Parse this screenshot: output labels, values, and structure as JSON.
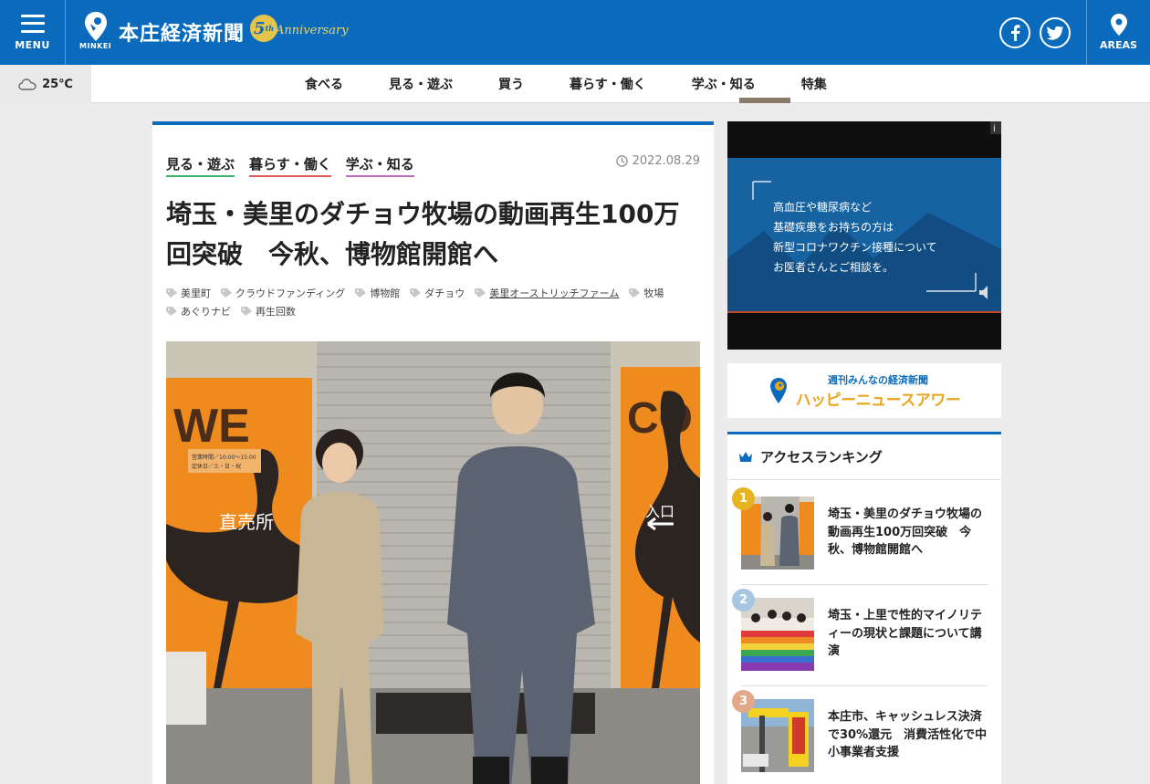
{
  "header": {
    "menu_label": "MENU",
    "site_name": "本庄経済新聞",
    "brand_sub": "MINKEI",
    "anniversary_number": "5",
    "anniversary_suffix": "th",
    "anniversary_word": "Anniversary",
    "areas_label": "AREAS",
    "brand_color": "#0a6bbd"
  },
  "weather": {
    "temperature": "25℃",
    "icon": "cloud-icon"
  },
  "nav": {
    "items": [
      {
        "label": "食べる"
      },
      {
        "label": "見る・遊ぶ"
      },
      {
        "label": "買う"
      },
      {
        "label": "暮らす・働く"
      },
      {
        "label": "学ぶ・知る"
      },
      {
        "label": "特集"
      }
    ]
  },
  "article": {
    "categories": [
      {
        "label": "見る・遊ぶ",
        "color": "#3bb36b"
      },
      {
        "label": "暮らす・働く",
        "color": "#e05a5a"
      },
      {
        "label": "学ぶ・知る",
        "color": "#c06ab3"
      }
    ],
    "date": "2022.08.29",
    "title": "埼玉・美里のダチョウ牧場の動画再生100万回突破　今秋、博物館開館へ",
    "tags": [
      {
        "label": "美里町"
      },
      {
        "label": "クラウドファンディング"
      },
      {
        "label": "博物館"
      },
      {
        "label": "ダチョウ"
      },
      {
        "label": "美里オーストリッチファーム"
      },
      {
        "label": "牧場"
      },
      {
        "label": "あぐりナビ"
      },
      {
        "label": "再生回数"
      }
    ],
    "photo": {
      "sign_left": "直売所",
      "sign_right": "入口",
      "hours_line1": "営業時間／10:00～15:00",
      "hours_line2": "定休日／土・日・祝",
      "wall_text_left": "WE",
      "wall_text_right": "CO"
    }
  },
  "ad": {
    "lines": [
      "高血圧や糖尿病など",
      "基礎疾患をお持ちの方は",
      "新型コロナワクチン接種について",
      "お医者さんとご相談を。"
    ],
    "info_badge": "i"
  },
  "happy": {
    "line1": "週刊みんなの経済新聞",
    "line2": "ハッピーニュースアワー"
  },
  "ranking": {
    "title": "アクセスランキング",
    "items": [
      {
        "rank": "1",
        "title": "埼玉・美里のダチョウ牧場の動画再生100万回突破　今秋、博物館開館へ",
        "badge_color": "#e6b422"
      },
      {
        "rank": "2",
        "title": "埼玉・上里で性的マイノリティーの現状と課題について講演",
        "badge_color": "#a9c6e0"
      },
      {
        "rank": "3",
        "title": "本庄市、キャッシュレス決済で30%還元　消費活性化で中小事業者支援",
        "badge_color": "#e0a98a"
      }
    ]
  }
}
